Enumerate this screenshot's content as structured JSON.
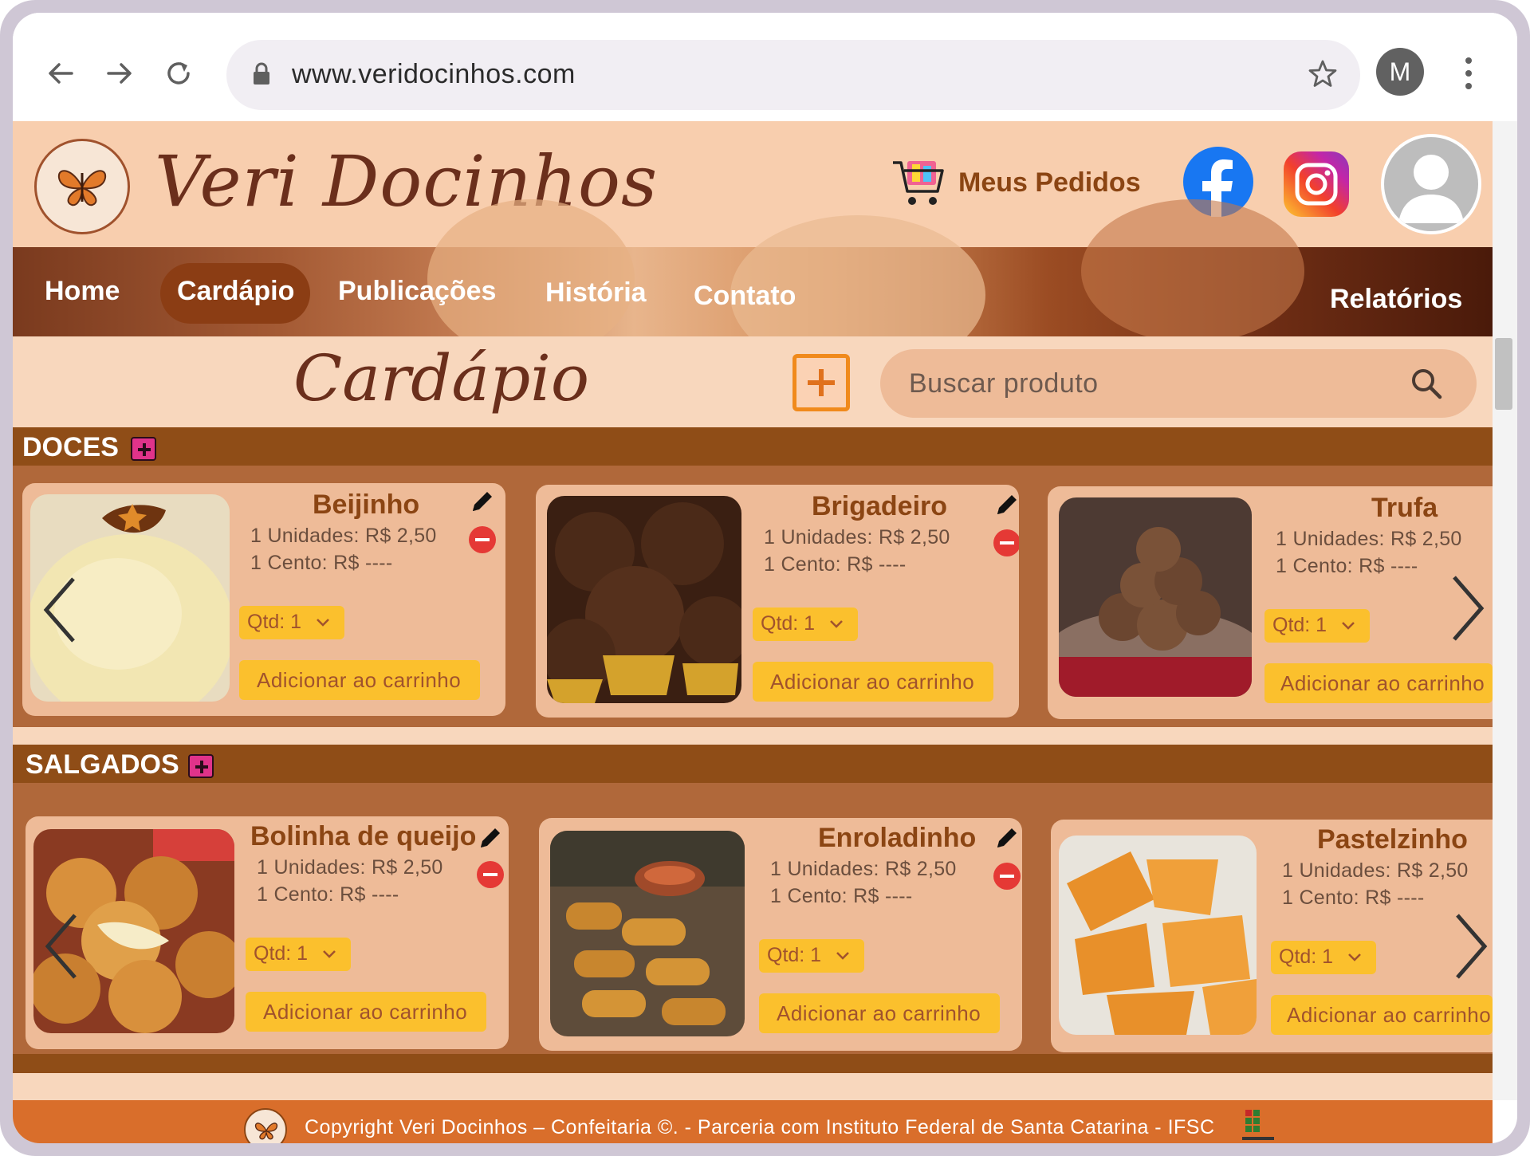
{
  "browser": {
    "url": "www.veridocinhos.com",
    "profile_initial": "M"
  },
  "header": {
    "brand": "Veri Docinhos",
    "orders_label": "Meus Pedidos"
  },
  "nav": {
    "items": [
      {
        "label": "Home"
      },
      {
        "label": "Cardápio"
      },
      {
        "label": "Publicações"
      },
      {
        "label": "História"
      },
      {
        "label": "Contato"
      },
      {
        "label": "Relatórios"
      }
    ],
    "active": "Cardápio"
  },
  "page": {
    "title": "Cardápio",
    "search_placeholder": "Buscar produto"
  },
  "categories": [
    {
      "name": "DOCES",
      "products": [
        {
          "name": "Beijinho",
          "unit_price": "1 Unidades: R$ 2,50",
          "cento_price": "1 Cento: R$ ----",
          "qty": "Qtd: 1",
          "add_label": "Adicionar ao carrinho"
        },
        {
          "name": "Brigadeiro",
          "unit_price": "1 Unidades: R$ 2,50",
          "cento_price": "1 Cento: R$ ----",
          "qty": "Qtd: 1",
          "add_label": "Adicionar ao carrinho"
        },
        {
          "name": "Trufa",
          "unit_price": "1 Unidades: R$ 2,50",
          "cento_price": "1 Cento: R$ ----",
          "qty": "Qtd: 1",
          "add_label": "Adicionar ao carrinho"
        }
      ]
    },
    {
      "name": "SALGADOS",
      "products": [
        {
          "name": "Bolinha de queijo",
          "unit_price": "1 Unidades: R$ 2,50",
          "cento_price": "1 Cento: R$ ----",
          "qty": "Qtd: 1",
          "add_label": "Adicionar ao carrinho"
        },
        {
          "name": "Enroladinho",
          "unit_price": "1 Unidades: R$ 2,50",
          "cento_price": "1 Cento: R$ ----",
          "qty": "Qtd: 1",
          "add_label": "Adicionar ao carrinho"
        },
        {
          "name": "Pastelzinho",
          "unit_price": "1 Unidades: R$ 2,50",
          "cento_price": "1 Cento: R$ ----",
          "qty": "Qtd: 1",
          "add_label": "Adicionar ao carrinho"
        }
      ]
    }
  ],
  "footer": {
    "text": "Copyright Veri Docinhos – Confeitaria ©. - Parceria com Instituto Federal de Santa Catarina - IFSC"
  },
  "colors": {
    "header_bg": "#f8ceae",
    "category_bar": "#8f4d17",
    "card_bg": "#eebb98",
    "button_yellow": "#fbc02d",
    "footer_bg": "#d96e2b",
    "brand_brown": "#6b2f1c"
  },
  "icons": [
    "back-arrow-icon",
    "forward-arrow-icon",
    "reload-icon",
    "lock-icon",
    "star-icon",
    "more-vert-icon",
    "cart-icon",
    "facebook-icon",
    "instagram-icon",
    "user-avatar-icon",
    "plus-icon",
    "search-icon",
    "pencil-icon",
    "minus-circle-icon",
    "chevron-down-icon",
    "chevron-left-icon",
    "chevron-right-icon"
  ]
}
